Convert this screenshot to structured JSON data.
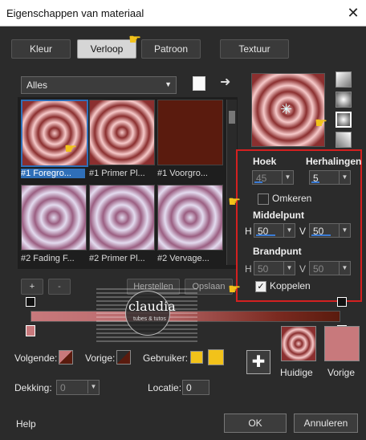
{
  "window": {
    "title": "Eigenschappen van materiaal"
  },
  "tabs": [
    "Kleur",
    "Verloop",
    "Patroon",
    "Textuur"
  ],
  "gallery_filter": "Alles",
  "gallery_items": [
    {
      "caption": "#1 Foregro..."
    },
    {
      "caption": "#1 Primer Pl..."
    },
    {
      "caption": "#1 Voorgro..."
    },
    {
      "caption": "#2 Fading F..."
    },
    {
      "caption": "#2 Primer Pl..."
    },
    {
      "caption": "#2 Vervage..."
    }
  ],
  "gallery_buttons": {
    "add": "+",
    "remove": "-",
    "restore": "Herstellen",
    "save": "Opslaan"
  },
  "properties": {
    "angle_label": "Hoek",
    "angle_value": "45",
    "repeats_label": "Herhalingen",
    "repeats_value": "5",
    "invert_label": "Omkeren",
    "center_label": "Middelpunt",
    "center_h_label": "H",
    "center_h": "50",
    "center_v_label": "V",
    "center_v": "50",
    "focal_label": "Brandpunt",
    "focal_h_label": "H",
    "focal_h": "50",
    "focal_v_label": "V",
    "focal_v": "50",
    "link_label": "Koppelen"
  },
  "bottom": {
    "next_label": "Volgende:",
    "prev_label": "Vorige:",
    "user_label": "Gebruiker:",
    "opacity_label": "Dekking:",
    "opacity_value": "0",
    "location_label": "Locatie:",
    "location_value": "0",
    "current_label": "Huidige",
    "previous_label": "Vorige"
  },
  "watermark": {
    "name": "claudia",
    "sub": "tubes & tutos"
  },
  "footer": {
    "help": "Help",
    "ok": "OK",
    "cancel": "Annuleren"
  },
  "colors": {
    "accent": "#2f6fb8",
    "highlight": "#d42020",
    "gradient_start": "#c8797c",
    "gradient_end": "#5a1b0e",
    "swatch_yellow": "#f2c21a"
  }
}
